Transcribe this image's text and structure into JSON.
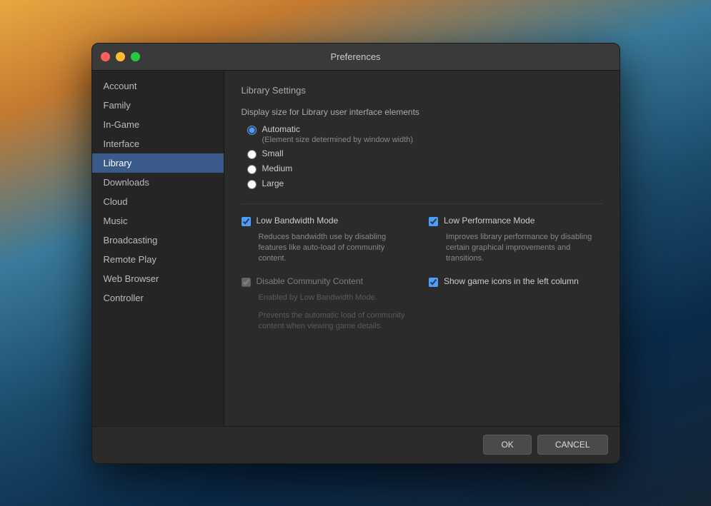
{
  "titlebar": {
    "title": "Preferences",
    "close_btn": "●",
    "minimize_btn": "●",
    "maximize_btn": "●"
  },
  "sidebar": {
    "items": [
      {
        "id": "account",
        "label": "Account",
        "active": false
      },
      {
        "id": "family",
        "label": "Family",
        "active": false
      },
      {
        "id": "in-game",
        "label": "In-Game",
        "active": false
      },
      {
        "id": "interface",
        "label": "Interface",
        "active": false
      },
      {
        "id": "library",
        "label": "Library",
        "active": true
      },
      {
        "id": "downloads",
        "label": "Downloads",
        "active": false
      },
      {
        "id": "cloud",
        "label": "Cloud",
        "active": false
      },
      {
        "id": "music",
        "label": "Music",
        "active": false
      },
      {
        "id": "broadcasting",
        "label": "Broadcasting",
        "active": false
      },
      {
        "id": "remote-play",
        "label": "Remote Play",
        "active": false
      },
      {
        "id": "web-browser",
        "label": "Web Browser",
        "active": false
      },
      {
        "id": "controller",
        "label": "Controller",
        "active": false
      }
    ]
  },
  "content": {
    "section_title": "Library Settings",
    "display_size_label": "Display size for Library user interface elements",
    "radio_options": [
      {
        "id": "automatic",
        "label": "Automatic",
        "sub": "(Element size determined by window width)",
        "checked": true
      },
      {
        "id": "small",
        "label": "Small",
        "checked": false
      },
      {
        "id": "medium",
        "label": "Medium",
        "checked": false
      },
      {
        "id": "large",
        "label": "Large",
        "checked": false
      }
    ],
    "checkboxes_left": [
      {
        "id": "low-bandwidth",
        "label": "Low Bandwidth Mode",
        "checked": true,
        "disabled": false,
        "desc": "Reduces bandwidth use by disabling features like auto-load of community content."
      },
      {
        "id": "disable-community",
        "label": "Disable Community Content",
        "checked": true,
        "disabled": true,
        "enabled_by": "Enabled by Low Bandwidth Mode.",
        "desc": "Prevents the automatic load of community content when viewing game details."
      }
    ],
    "checkboxes_right": [
      {
        "id": "low-performance",
        "label": "Low Performance Mode",
        "checked": true,
        "disabled": false,
        "desc": "Improves library performance by disabling certain graphical improvements and transitions."
      },
      {
        "id": "show-game-icons",
        "label": "Show game icons in the left column",
        "checked": true,
        "disabled": false,
        "desc": ""
      }
    ]
  },
  "footer": {
    "ok_label": "OK",
    "cancel_label": "CANCEL"
  }
}
